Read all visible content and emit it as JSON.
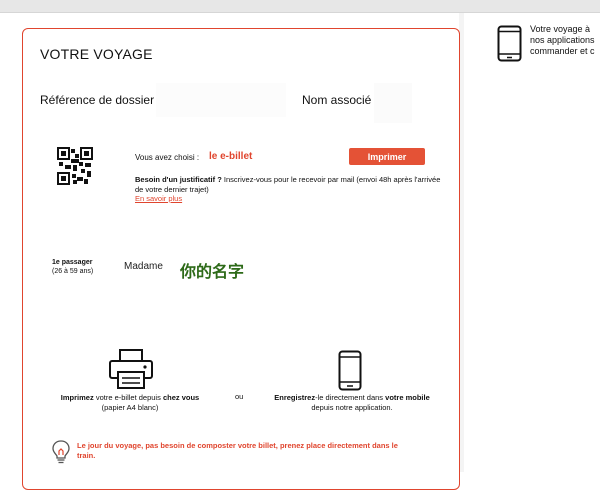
{
  "voyage": {
    "title": "VOTRE VOYAGE",
    "reference_label": "Référence de dossier :",
    "nom_label": "Nom associé :"
  },
  "ticket": {
    "chosen_prefix": "Vous avez choisi :",
    "chosen_value": "le e-billet",
    "print_button": "Imprimer",
    "justif_bold": "Besoin d'un justificatif ?",
    "justif_text": " Inscrivez-vous pour le recevoir par mail (envoi 48h après l'arrivée de votre dernier trajet)",
    "learn_more": "En savoir plus"
  },
  "passenger": {
    "label": "1e passager",
    "age": "(26 à 59 ans)",
    "civility": "Madame",
    "name": "你的名字"
  },
  "options": {
    "print_bold": "Imprimez",
    "print_mid": " votre e-billet depuis ",
    "print_bold2": "chez vous",
    "print_sub": "(papier A4 blanc)",
    "or": "ou",
    "save_bold": "Enregistrez",
    "save_mid": "-le directement dans ",
    "save_bold2": "votre mobile",
    "save_sub": "depuis notre application."
  },
  "tip": {
    "text": "Le jour du voyage, pas besoin de composter votre billet, prenez place directement dans le train."
  },
  "side": {
    "line1": "Votre voyage à",
    "line2": "nos applications",
    "line3": "commander et c"
  },
  "colors": {
    "accent": "#e0452e",
    "button": "#e45236",
    "name": "#2d6a18"
  },
  "icons": [
    "qr-code-icon",
    "printer-icon",
    "mobile-phone-icon",
    "lightbulb-icon"
  ]
}
